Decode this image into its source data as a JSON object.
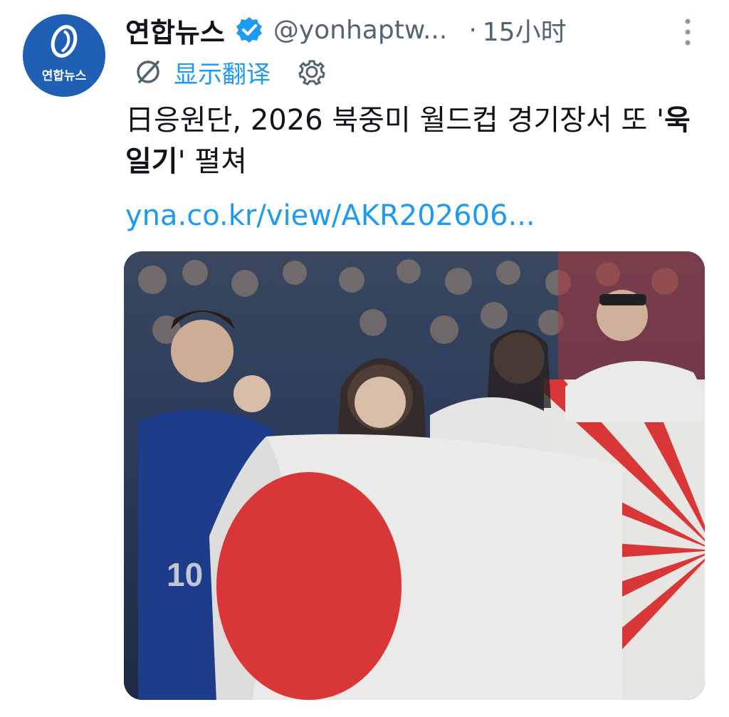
{
  "tweet": {
    "avatar_text": "연합뉴스",
    "display_name": "연합뉴스",
    "handle": "@yonhaptw...",
    "separator": "·",
    "time": "15小时",
    "translate_label": "显示翻译",
    "text_part1": "日응원단, 2026 북중미 월드컵 경기장서 또 '",
    "text_bold": "욱일기",
    "text_part2": "' 펼쳐",
    "link": "yna.co.kr/view/AKR202606...",
    "media_description": "stadium-crowd-with-japan-and-rising-sun-flags"
  },
  "colors": {
    "avatar_bg": "#1f5fb4",
    "verified": "#1d9bf0",
    "link": "#1d9bf0",
    "muted": "#536471",
    "flag_red": "#e23a3a"
  },
  "icons": [
    "verified-icon",
    "more-options-icon",
    "translate-icon",
    "gear-icon",
    "logo-mark-icon"
  ]
}
